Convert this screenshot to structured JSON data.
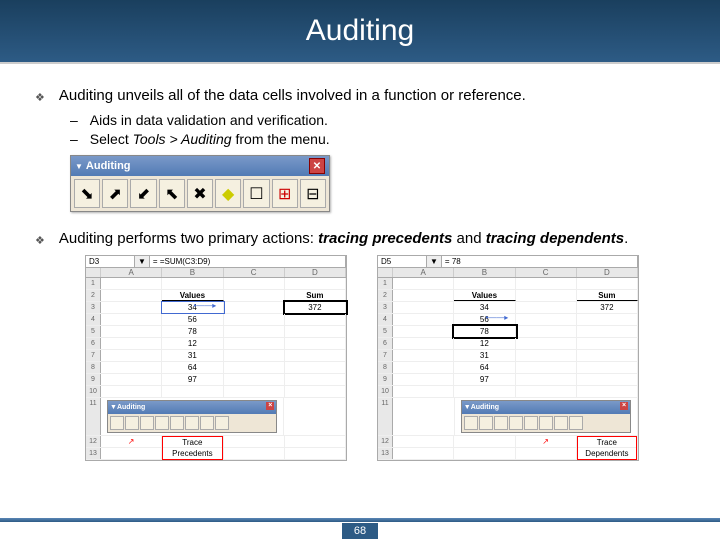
{
  "title": "Auditing",
  "bullet1": "Auditing unveils all of the data cells involved in a function or reference.",
  "sub1": "Aids in data validation and verification.",
  "sub2_pre": "Select ",
  "sub2_em": "Tools > Auditing",
  "sub2_post": " from the menu.",
  "toolbar_title": "Auditing",
  "bullet2_pre": "Auditing performs two primary actions: ",
  "bullet2_em1": "tracing precedents",
  "bullet2_mid": " and ",
  "bullet2_em2": "tracing dependents",
  "bullet2_post": ".",
  "sheet1": {
    "ref": "D3",
    "formula": "= =SUM(C3:D9)",
    "colB_hdr": "Values",
    "colD_hdr": "Sum",
    "vals": [
      "34",
      "56",
      "78",
      "12",
      "31",
      "64",
      "97"
    ],
    "sum": "372",
    "tb": "Auditing",
    "label": "Trace Precedents"
  },
  "sheet2": {
    "ref": "D5",
    "formula": "= 78",
    "colB_hdr": "Values",
    "colD_hdr": "Sum",
    "vals": [
      "34",
      "56",
      "78",
      "12",
      "31",
      "64",
      "97"
    ],
    "sum": "372",
    "tb": "Auditing",
    "label": "Trace Dependents"
  },
  "page": "68"
}
